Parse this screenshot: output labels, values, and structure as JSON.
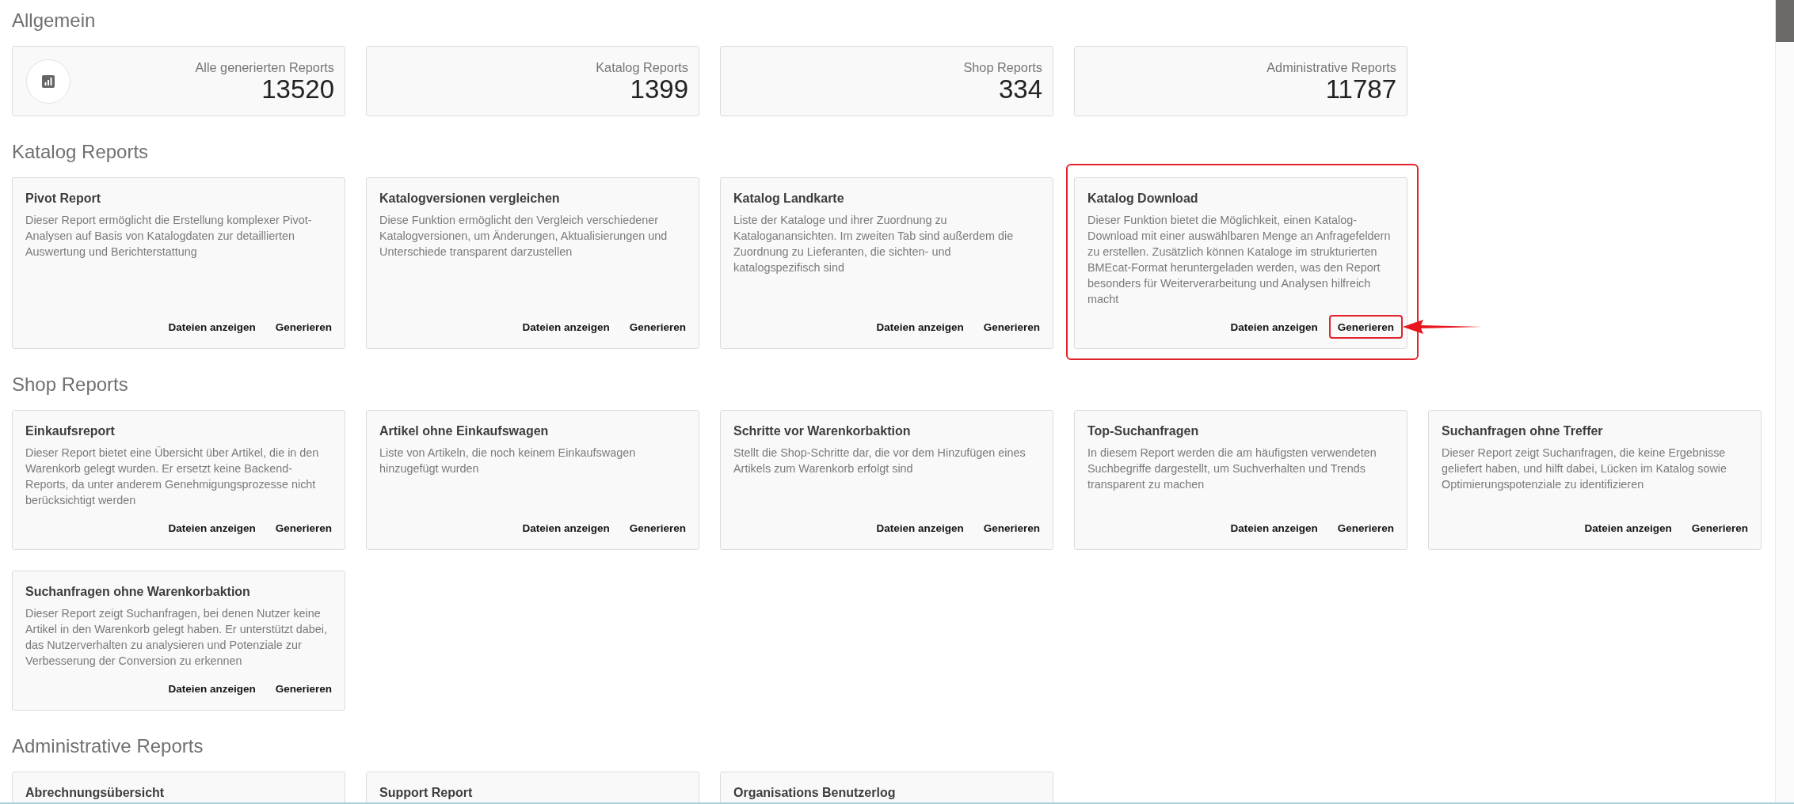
{
  "sections": [
    {
      "title": "Allgemein",
      "kind": "stats",
      "stats": [
        {
          "label": "Alle generierten Reports",
          "value": "13520",
          "icon": true
        },
        {
          "label": "Katalog Reports",
          "value": "1399",
          "icon": false
        },
        {
          "label": "Shop Reports",
          "value": "334",
          "icon": false
        },
        {
          "label": "Administrative Reports",
          "value": "11787",
          "icon": false
        }
      ]
    },
    {
      "title": "Katalog Reports",
      "kind": "reports",
      "cards": [
        {
          "title": "Pivot Report",
          "description": "Dieser Report ermöglicht die Erstellung komplexer Pivot-Analysen auf Basis von Katalogdaten zur detaillierten Auswertung und Berichterstattung",
          "highlighted": false,
          "actions": [
            {
              "label": "Dateien anzeigen",
              "highlighted": false
            },
            {
              "label": "Generieren",
              "highlighted": false
            }
          ]
        },
        {
          "title": "Katalogversionen vergleichen",
          "description": "Diese Funktion ermöglicht den Vergleich verschiedener Katalogversionen, um Änderungen, Aktualisierungen und Unterschiede transparent darzustellen",
          "highlighted": false,
          "actions": [
            {
              "label": "Dateien anzeigen",
              "highlighted": false
            },
            {
              "label": "Generieren",
              "highlighted": false
            }
          ]
        },
        {
          "title": "Katalog Landkarte",
          "description": "Liste der Kataloge und ihrer Zuordnung zu Kataloganansichten. Im zweiten Tab sind außerdem die Zuordnung zu Lieferanten, die sichten- und katalogspezifisch sind",
          "highlighted": false,
          "actions": [
            {
              "label": "Dateien anzeigen",
              "highlighted": false
            },
            {
              "label": "Generieren",
              "highlighted": false
            }
          ]
        },
        {
          "title": "Katalog Download",
          "description": "Dieser Funktion bietet die Möglichkeit, einen Katalog-Download mit einer auswählbaren Menge an Anfragefeldern zu erstellen. Zusätzlich können Kataloge im strukturierten BMEcat-Format heruntergeladen werden, was den Report besonders für Weiterverarbeitung und Analysen hilfreich macht",
          "highlighted": true,
          "actions": [
            {
              "label": "Dateien anzeigen",
              "highlighted": false
            },
            {
              "label": "Generieren",
              "highlighted": true
            }
          ]
        }
      ]
    },
    {
      "title": "Shop Reports",
      "kind": "reports",
      "cards": [
        {
          "title": "Einkaufsreport",
          "description": "Dieser Report bietet eine Übersicht über Artikel, die in den Warenkorb gelegt wurden. Er ersetzt keine Backend-Reports, da unter anderem Genehmigungsprozesse nicht berücksichtigt werden",
          "highlighted": false,
          "actions": [
            {
              "label": "Dateien anzeigen",
              "highlighted": false
            },
            {
              "label": "Generieren",
              "highlighted": false
            }
          ]
        },
        {
          "title": "Artikel ohne Einkaufswagen",
          "description": "Liste von Artikeln, die noch keinem Einkaufswagen hinzugefügt wurden",
          "highlighted": false,
          "actions": [
            {
              "label": "Dateien anzeigen",
              "highlighted": false
            },
            {
              "label": "Generieren",
              "highlighted": false
            }
          ]
        },
        {
          "title": "Schritte vor Warenkorbaktion",
          "description": "Stellt die Shop-Schritte dar, die vor dem Hinzufügen eines Artikels zum Warenkorb erfolgt sind",
          "highlighted": false,
          "actions": [
            {
              "label": "Dateien anzeigen",
              "highlighted": false
            },
            {
              "label": "Generieren",
              "highlighted": false
            }
          ]
        },
        {
          "title": "Top-Suchanfragen",
          "description": "In diesem Report werden die am häufigsten verwendeten Suchbegriffe dargestellt, um Suchverhalten und Trends transparent zu machen",
          "highlighted": false,
          "actions": [
            {
              "label": "Dateien anzeigen",
              "highlighted": false
            },
            {
              "label": "Generieren",
              "highlighted": false
            }
          ]
        },
        {
          "title": "Suchanfragen ohne Treffer",
          "description": "Dieser Report zeigt Suchanfragen, die keine Ergebnisse geliefert haben, und hilft dabei, Lücken im Katalog sowie Optimierungspotenziale zu identifizieren",
          "highlighted": false,
          "actions": [
            {
              "label": "Dateien anzeigen",
              "highlighted": false
            },
            {
              "label": "Generieren",
              "highlighted": false
            }
          ]
        },
        {
          "title": "Suchanfragen ohne Warenkorbaktion",
          "description": "Dieser Report zeigt Suchanfragen, bei denen Nutzer keine Artikel in den Warenkorb gelegt haben. Er unterstützt dabei, das Nutzerverhalten zu analysieren und Potenziale zur Verbesserung der Conversion zu erkennen",
          "highlighted": false,
          "actions": [
            {
              "label": "Dateien anzeigen",
              "highlighted": false
            },
            {
              "label": "Generieren",
              "highlighted": false
            }
          ]
        }
      ]
    },
    {
      "title": "Administrative Reports",
      "kind": "reports",
      "cards": [
        {
          "title": "Abrechnungsübersicht",
          "highlighted": false
        },
        {
          "title": "Support Report",
          "highlighted": false
        },
        {
          "title": "Organisations Benutzerlog",
          "highlighted": false
        }
      ]
    }
  ]
}
